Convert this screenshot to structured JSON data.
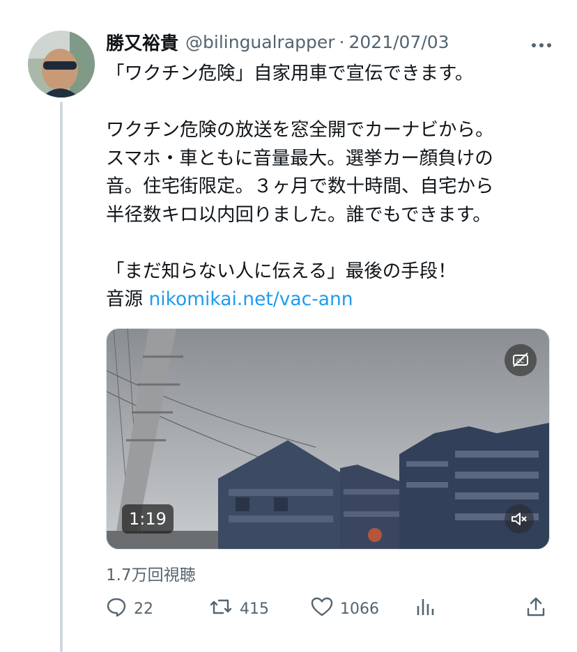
{
  "author": {
    "name": "勝又裕貴",
    "handle": "@bilingualrapper",
    "separator": "·",
    "date": "2021/07/03"
  },
  "tweet": {
    "lines": [
      "「ワクチン危険」自家用車で宣伝できます。",
      "",
      "ワクチン危険の放送を窓全開でカーナビから。",
      "スマホ・車ともに音量最大。選挙カー顔負けの",
      "音。住宅街限定。３ヶ月で数十時間、自宅から",
      "半径数キロ以内回りました。誰でもできます。",
      "",
      "「まだ知らない人に伝える」最後の手段！"
    ],
    "source_prefix": "音源",
    "link_text": "nikomikai.net/vac-ann"
  },
  "video": {
    "duration": "1:19"
  },
  "views": "1.7万回視聴",
  "actions": {
    "replies": "22",
    "retweets": "415",
    "likes": "1066"
  },
  "icons": {
    "more": "more-icon",
    "captions": "captions-off-icon",
    "mute": "muted-speaker-icon",
    "reply": "reply-icon",
    "retweet": "retweet-icon",
    "like": "heart-icon",
    "analytics": "analytics-icon",
    "share": "share-icon"
  },
  "colors": {
    "text": "#0f1419",
    "secondary": "#536471",
    "link": "#1d9bf0",
    "thread_line": "#cfd9de"
  }
}
